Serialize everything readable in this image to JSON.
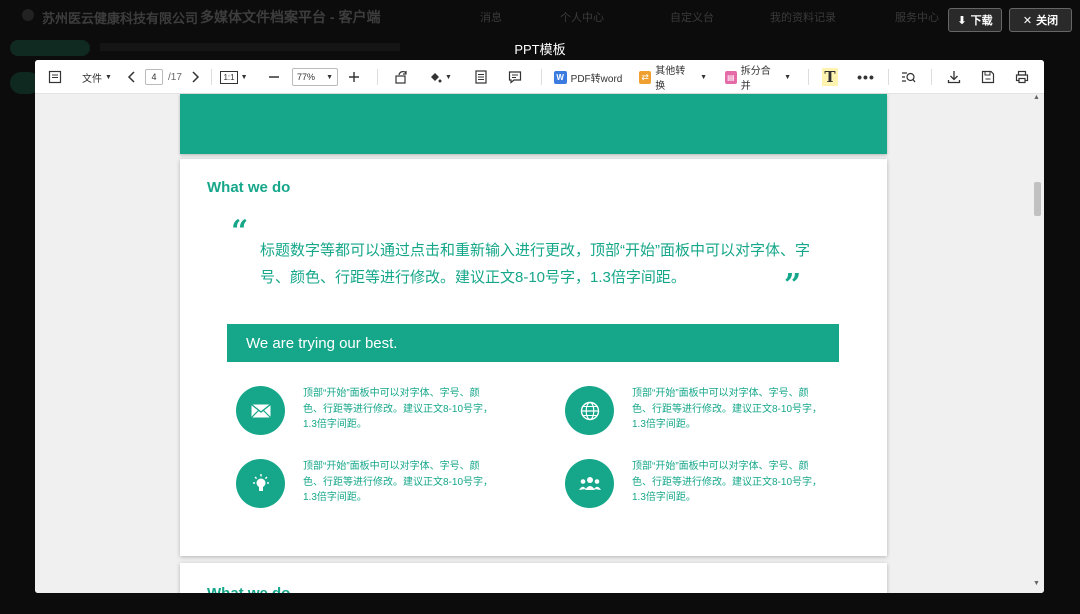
{
  "background_app": {
    "company": "苏州医云健康科技有限公司",
    "platform": "多媒体文件档案平台 - 客户端",
    "nav": [
      "消息",
      "个人中心",
      "自定义台",
      "我的资料记录",
      "服务中心"
    ]
  },
  "modal": {
    "title": "PPT模板",
    "download_label": "下载",
    "close_label": "关闭"
  },
  "toolbar": {
    "file_menu": "文件",
    "current_page": "4",
    "total_pages": "/17",
    "fit_label": "1:1",
    "zoom": "77%",
    "pdf_to_word": "PDF转word",
    "other_convert": "其他转换",
    "split_merge": "拆分合并"
  },
  "slide": {
    "heading": "What we do",
    "quote": "标题数字等都可以通过点击和重新输入进行更改，顶部“开始”面板中可以对字体、字号、颜色、行距等进行修改。建议正文8-10号字，1.3倍字间距。",
    "banner": "We are trying our best.",
    "features": [
      {
        "icon": "envelope-icon",
        "text": "顶部“开始”面板中可以对字体、字号、颜色、行距等进行修改。建议正文8-10号字，1.3倍字间距。"
      },
      {
        "icon": "globe-icon",
        "text": "顶部“开始”面板中可以对字体、字号、颜色、行距等进行修改。建议正文8-10号字，1.3倍字间距。"
      },
      {
        "icon": "lightbulb-icon",
        "text": "顶部“开始”面板中可以对字体、字号、颜色、行距等进行修改。建议正文8-10号字，1.3倍字间距。"
      },
      {
        "icon": "people-icon",
        "text": "顶部“开始”面板中可以对字体、字号、颜色、行距等进行修改。建议正文8-10号字，1.3倍字间距。"
      }
    ]
  },
  "next_slide": {
    "heading": "What we do"
  },
  "colors": {
    "accent": "#16a78a",
    "backdrop": "#0c0c0c"
  }
}
